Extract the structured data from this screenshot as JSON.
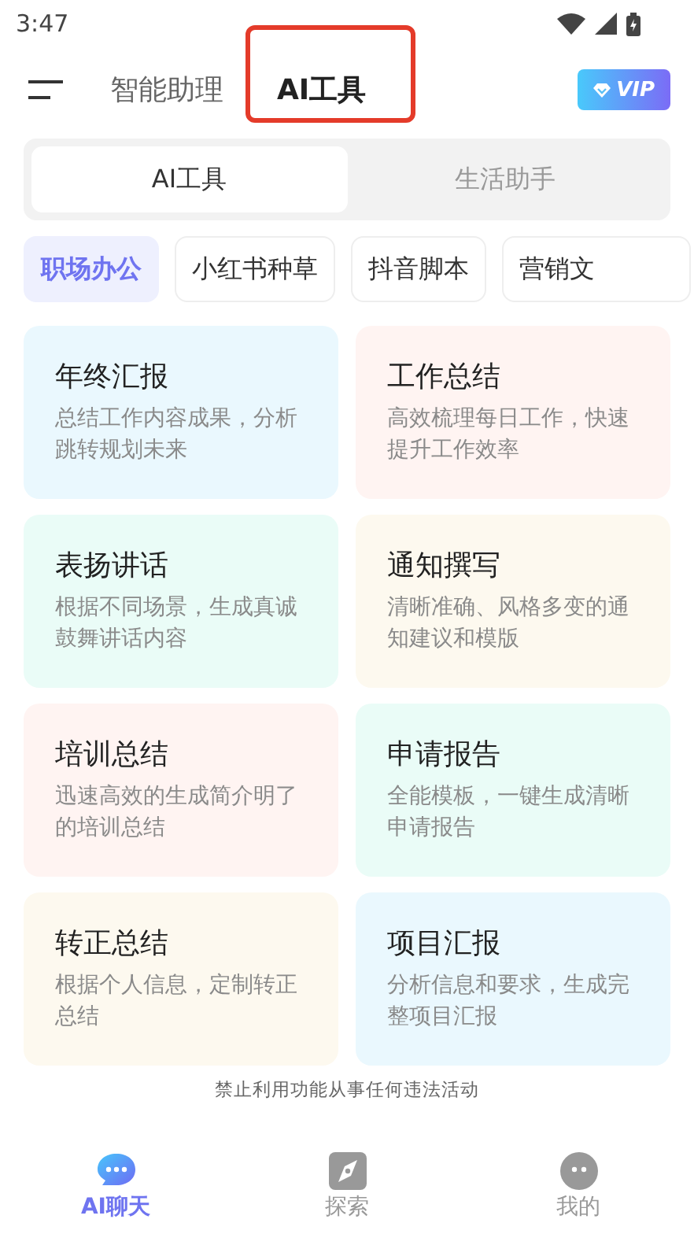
{
  "status_bar": {
    "time": "3:47"
  },
  "header": {
    "tabs": [
      {
        "label": "智能助理",
        "selected": false
      },
      {
        "label": "AI工具",
        "selected": true,
        "highlighted": true
      }
    ],
    "vip": "VIP"
  },
  "segments": [
    {
      "label": "AI工具",
      "selected": true
    },
    {
      "label": "生活助手",
      "selected": false
    }
  ],
  "chips": [
    {
      "label": "职场办公",
      "selected": true
    },
    {
      "label": "小红书种草",
      "selected": false
    },
    {
      "label": "抖音脚本",
      "selected": false
    },
    {
      "label": "营销文",
      "selected": false
    }
  ],
  "cards": [
    {
      "title": "年终汇报",
      "description": "总结工作内容成果，分析跳转规划未来",
      "color": "#eaf8fe"
    },
    {
      "title": "工作总结",
      "description": "高效梳理每日工作，快速提升工作效率",
      "color": "#fff4f2"
    },
    {
      "title": "表扬讲话",
      "description": "根据不同场景，生成真诚鼓舞讲话内容",
      "color": "#eafcf7"
    },
    {
      "title": "通知撰写",
      "description": "清晰准确、风格多变的通知建议和模版",
      "color": "#fdf9ef"
    },
    {
      "title": "培训总结",
      "description": "迅速高效的生成简介明了的培训总结",
      "color": "#fff4f2"
    },
    {
      "title": "申请报告",
      "description": "全能模板，一键生成清晰申请报告",
      "color": "#eafcf7"
    },
    {
      "title": "转正总结",
      "description": "根据个人信息，定制转正总结",
      "color": "#fdf9ef"
    },
    {
      "title": "项目汇报",
      "description": "分析信息和要求，生成完整项目汇报",
      "color": "#eaf8fe"
    }
  ],
  "notice": "禁止利用功能从事任何违法活动",
  "nav": [
    {
      "kind": "chat",
      "label": "AI聊天",
      "selected": true
    },
    {
      "kind": "explore",
      "label": "探索",
      "selected": false
    },
    {
      "kind": "profile",
      "label": "我的",
      "selected": false
    }
  ]
}
